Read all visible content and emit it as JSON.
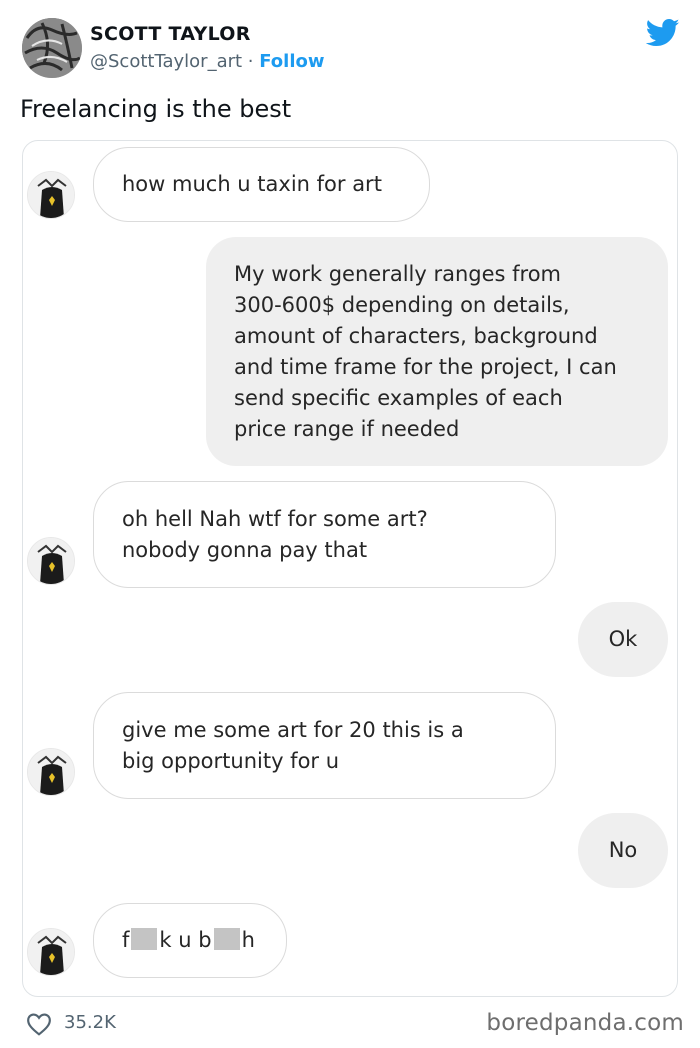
{
  "tweet": {
    "author_name": "SCOTT TAYLOR",
    "handle": "@ScottTaylor_art",
    "separator": " · ",
    "follow_label": "Follow",
    "text": "Freelancing is the best",
    "likes": "35.2K"
  },
  "chat": {
    "messages": [
      {
        "from": "them",
        "text": "how much u taxin for art"
      },
      {
        "from": "me",
        "text": "My work generally ranges from\n300-600$ depending on details,\namount of characters, background\nand time frame for the project, I can\nsend specific examples of each\nprice range if needed"
      },
      {
        "from": "them",
        "text": "oh hell Nah wtf for some art?\nnobody gonna pay that"
      },
      {
        "from": "me",
        "text": "Ok"
      },
      {
        "from": "them",
        "text": "give me some art for 20 this is a\nbig opportunity for u"
      },
      {
        "from": "me",
        "text": "No"
      },
      {
        "from": "them",
        "parts": [
          "f",
          "k u b",
          "h"
        ]
      }
    ]
  },
  "footer": {
    "watermark": "boredpanda.com"
  },
  "colors": {
    "twitter_blue": "#1d9bf0",
    "outgoing_bubble": "#efefef",
    "incoming_border": "#dbdbdb",
    "censor_gray": "#c4c4c4"
  },
  "icons": [
    "twitter-bird-icon",
    "heart-icon"
  ]
}
